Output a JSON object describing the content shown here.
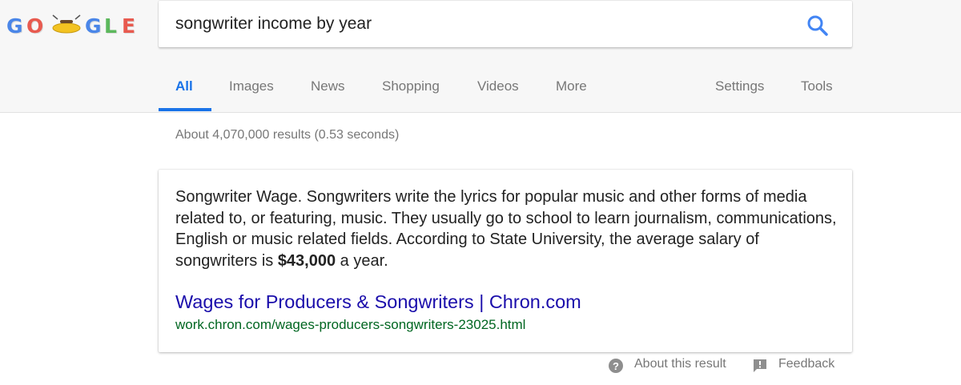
{
  "logo": {
    "letters": [
      "G",
      "O",
      "G",
      "L",
      "E"
    ],
    "colors": [
      "#4a86e8",
      "#e85a4f",
      "#4a86e8",
      "#5cb85c",
      "#e85a4f"
    ]
  },
  "search": {
    "query": "songwriter income by year",
    "icon": "search-icon"
  },
  "tabs": {
    "all": "All",
    "images": "Images",
    "news": "News",
    "shopping": "Shopping",
    "videos": "Videos",
    "more": "More",
    "settings": "Settings",
    "tools": "Tools"
  },
  "stats": "About 4,070,000 results (0.53 seconds)",
  "featured": {
    "snippet_before": "Songwriter Wage. Songwriters write the lyrics for popular music and other forms of media related to, or featuring, music. They usually go to school to learn journalism, communications, English or music related fields. According to State University, the average salary of songwriters is ",
    "snippet_bold": "$43,000",
    "snippet_after": " a year.",
    "link_title": "Wages for Producers & Songwriters | Chron.com",
    "url": "work.chron.com/wages-producers-songwriters-23025.html"
  },
  "footer": {
    "about": "About this result",
    "feedback": "Feedback"
  },
  "colors": {
    "accent": "#1a73e8",
    "link": "#1a0dab",
    "url": "#006621"
  }
}
